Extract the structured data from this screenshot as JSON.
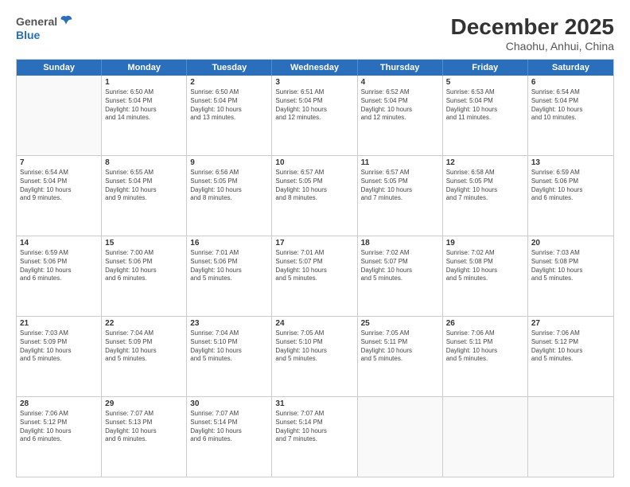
{
  "header": {
    "logo_line1": "General",
    "logo_line2": "Blue",
    "month": "December 2025",
    "location": "Chaohu, Anhui, China"
  },
  "days": [
    "Sunday",
    "Monday",
    "Tuesday",
    "Wednesday",
    "Thursday",
    "Friday",
    "Saturday"
  ],
  "weeks": [
    [
      {
        "day": "",
        "text": ""
      },
      {
        "day": "1",
        "text": "Sunrise: 6:50 AM\nSunset: 5:04 PM\nDaylight: 10 hours\nand 14 minutes."
      },
      {
        "day": "2",
        "text": "Sunrise: 6:50 AM\nSunset: 5:04 PM\nDaylight: 10 hours\nand 13 minutes."
      },
      {
        "day": "3",
        "text": "Sunrise: 6:51 AM\nSunset: 5:04 PM\nDaylight: 10 hours\nand 12 minutes."
      },
      {
        "day": "4",
        "text": "Sunrise: 6:52 AM\nSunset: 5:04 PM\nDaylight: 10 hours\nand 12 minutes."
      },
      {
        "day": "5",
        "text": "Sunrise: 6:53 AM\nSunset: 5:04 PM\nDaylight: 10 hours\nand 11 minutes."
      },
      {
        "day": "6",
        "text": "Sunrise: 6:54 AM\nSunset: 5:04 PM\nDaylight: 10 hours\nand 10 minutes."
      }
    ],
    [
      {
        "day": "7",
        "text": "Sunrise: 6:54 AM\nSunset: 5:04 PM\nDaylight: 10 hours\nand 9 minutes."
      },
      {
        "day": "8",
        "text": "Sunrise: 6:55 AM\nSunset: 5:04 PM\nDaylight: 10 hours\nand 9 minutes."
      },
      {
        "day": "9",
        "text": "Sunrise: 6:56 AM\nSunset: 5:05 PM\nDaylight: 10 hours\nand 8 minutes."
      },
      {
        "day": "10",
        "text": "Sunrise: 6:57 AM\nSunset: 5:05 PM\nDaylight: 10 hours\nand 8 minutes."
      },
      {
        "day": "11",
        "text": "Sunrise: 6:57 AM\nSunset: 5:05 PM\nDaylight: 10 hours\nand 7 minutes."
      },
      {
        "day": "12",
        "text": "Sunrise: 6:58 AM\nSunset: 5:05 PM\nDaylight: 10 hours\nand 7 minutes."
      },
      {
        "day": "13",
        "text": "Sunrise: 6:59 AM\nSunset: 5:06 PM\nDaylight: 10 hours\nand 6 minutes."
      }
    ],
    [
      {
        "day": "14",
        "text": "Sunrise: 6:59 AM\nSunset: 5:06 PM\nDaylight: 10 hours\nand 6 minutes."
      },
      {
        "day": "15",
        "text": "Sunrise: 7:00 AM\nSunset: 5:06 PM\nDaylight: 10 hours\nand 6 minutes."
      },
      {
        "day": "16",
        "text": "Sunrise: 7:01 AM\nSunset: 5:06 PM\nDaylight: 10 hours\nand 5 minutes."
      },
      {
        "day": "17",
        "text": "Sunrise: 7:01 AM\nSunset: 5:07 PM\nDaylight: 10 hours\nand 5 minutes."
      },
      {
        "day": "18",
        "text": "Sunrise: 7:02 AM\nSunset: 5:07 PM\nDaylight: 10 hours\nand 5 minutes."
      },
      {
        "day": "19",
        "text": "Sunrise: 7:02 AM\nSunset: 5:08 PM\nDaylight: 10 hours\nand 5 minutes."
      },
      {
        "day": "20",
        "text": "Sunrise: 7:03 AM\nSunset: 5:08 PM\nDaylight: 10 hours\nand 5 minutes."
      }
    ],
    [
      {
        "day": "21",
        "text": "Sunrise: 7:03 AM\nSunset: 5:09 PM\nDaylight: 10 hours\nand 5 minutes."
      },
      {
        "day": "22",
        "text": "Sunrise: 7:04 AM\nSunset: 5:09 PM\nDaylight: 10 hours\nand 5 minutes."
      },
      {
        "day": "23",
        "text": "Sunrise: 7:04 AM\nSunset: 5:10 PM\nDaylight: 10 hours\nand 5 minutes."
      },
      {
        "day": "24",
        "text": "Sunrise: 7:05 AM\nSunset: 5:10 PM\nDaylight: 10 hours\nand 5 minutes."
      },
      {
        "day": "25",
        "text": "Sunrise: 7:05 AM\nSunset: 5:11 PM\nDaylight: 10 hours\nand 5 minutes."
      },
      {
        "day": "26",
        "text": "Sunrise: 7:06 AM\nSunset: 5:11 PM\nDaylight: 10 hours\nand 5 minutes."
      },
      {
        "day": "27",
        "text": "Sunrise: 7:06 AM\nSunset: 5:12 PM\nDaylight: 10 hours\nand 5 minutes."
      }
    ],
    [
      {
        "day": "28",
        "text": "Sunrise: 7:06 AM\nSunset: 5:12 PM\nDaylight: 10 hours\nand 6 minutes."
      },
      {
        "day": "29",
        "text": "Sunrise: 7:07 AM\nSunset: 5:13 PM\nDaylight: 10 hours\nand 6 minutes."
      },
      {
        "day": "30",
        "text": "Sunrise: 7:07 AM\nSunset: 5:14 PM\nDaylight: 10 hours\nand 6 minutes."
      },
      {
        "day": "31",
        "text": "Sunrise: 7:07 AM\nSunset: 5:14 PM\nDaylight: 10 hours\nand 7 minutes."
      },
      {
        "day": "",
        "text": ""
      },
      {
        "day": "",
        "text": ""
      },
      {
        "day": "",
        "text": ""
      }
    ]
  ]
}
